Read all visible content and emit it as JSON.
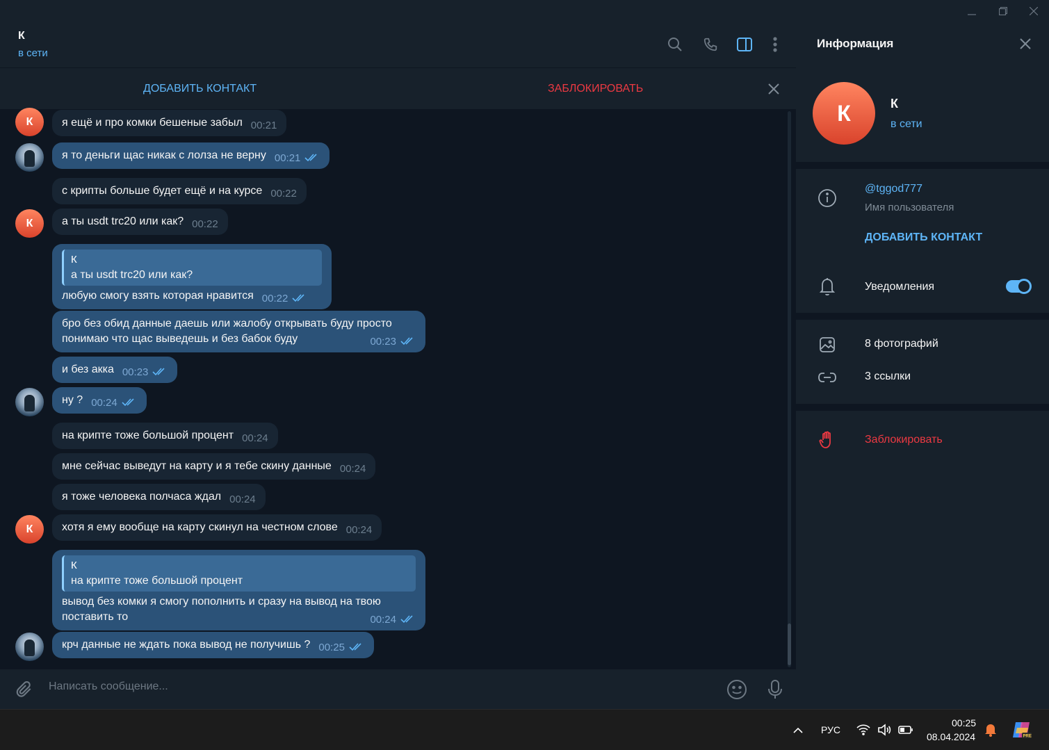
{
  "window": {
    "minimize_icon": "minimize-icon",
    "restore_icon": "restore-icon",
    "close_icon": "close-icon"
  },
  "header": {
    "peer_name": "К",
    "peer_status": "в сети"
  },
  "action_bar": {
    "add_contact": "ДОБАВИТЬ КОНТАКТ",
    "block": "ЗАБЛОКИРОВАТЬ"
  },
  "messages": [
    {
      "text": "я ещё и про комки бешеные забыл",
      "time": "00:21",
      "out": false
    },
    {
      "text": "я то деньги щас никак с лолза не верну",
      "time": "00:21",
      "out": true
    },
    {
      "text": "с крипты больше будет ещё и на курсе",
      "time": "00:22",
      "out": false
    },
    {
      "text": "а ты usdt trc20 или как?",
      "time": "00:22",
      "out": false
    },
    {
      "reply_name": "К",
      "reply_text": "а ты usdt trc20 или как?",
      "text": "любую смогу взять которая нравится",
      "time": "00:22",
      "out": true
    },
    {
      "text_line1": "бро без обид данные даешь или жалобу открывать буду просто",
      "text_line2": "понимаю что щас выведешь и без бабок буду",
      "time": "00:23",
      "out": true
    },
    {
      "text": "и без акка",
      "time": "00:23",
      "out": true
    },
    {
      "text": "ну ?",
      "time": "00:24",
      "out": true
    },
    {
      "text": "на крипте тоже большой процент",
      "time": "00:24",
      "out": false
    },
    {
      "text": "мне сейчас выведут на карту и я тебе скину данные",
      "time": "00:24",
      "out": false
    },
    {
      "text": "я тоже человека полчаса ждал",
      "time": "00:24",
      "out": false
    },
    {
      "text": "хотя я ему вообще на карту скинул на честном слове",
      "time": "00:24",
      "out": false
    },
    {
      "reply_name": "К",
      "reply_text": "на крипте тоже большой процент",
      "text_line1": "вывод без комки я смогу пополнить и сразу на вывод на твою",
      "text_line2": "поставить то",
      "time": "00:24",
      "out": true
    },
    {
      "text": "крч данные не ждать пока вывод не получишь ?",
      "time": "00:25",
      "out": true
    }
  ],
  "avatar_letter": "К",
  "composer": {
    "placeholder": "Написать сообщение..."
  },
  "info": {
    "title": "Информация",
    "name": "К",
    "status": "в сети",
    "username": "@tggod777",
    "username_label": "Имя пользователя",
    "add_contact": "ДОБАВИТЬ КОНТАКТ",
    "notifications": "Уведомления",
    "notifications_on": true,
    "photos": "8 фотографий",
    "links": "3 ссылки",
    "block": "Заблокировать"
  },
  "taskbar": {
    "language": "РУС",
    "time": "00:25",
    "date": "08.04.2024"
  },
  "colors": {
    "accent": "#5eb5f7",
    "danger": "#ec3942",
    "outgoing_bubble": "#2b5278",
    "incoming_bubble": "#182533",
    "background": "#0e1621",
    "panel": "#17212b"
  }
}
